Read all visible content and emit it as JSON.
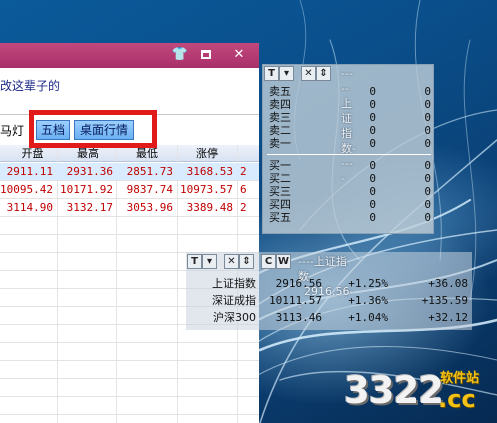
{
  "window": {
    "controls": {
      "skin": "👕",
      "maximize": "□",
      "close": "✕"
    },
    "info_text": "改这辈子的"
  },
  "tabs": {
    "marquee_label": "马灯",
    "five_levels": "五档",
    "desktop_quotes": "桌面行情"
  },
  "grid": {
    "headers": [
      "开盘",
      "最高",
      "最低",
      "涨停"
    ],
    "rows": [
      [
        "2911.11",
        "2931.36",
        "2851.73",
        "3168.53"
      ],
      [
        "10095.42",
        "10171.92",
        "9837.74",
        "10973.57"
      ],
      [
        "3114.90",
        "3132.17",
        "3053.96",
        "3389.48"
      ]
    ],
    "row_tails": [
      "2",
      "6",
      "2"
    ]
  },
  "order_book": {
    "toolbar": [
      "T",
      "▾",
      "✕",
      "⇕"
    ],
    "title": "上证指数",
    "sell_rows": [
      {
        "label": "卖五",
        "v1": "0",
        "v2": "0"
      },
      {
        "label": "卖四",
        "v1": "0",
        "v2": "0"
      },
      {
        "label": "卖三",
        "v1": "0",
        "v2": "0"
      },
      {
        "label": "卖二",
        "v1": "0",
        "v2": "0"
      },
      {
        "label": "卖一",
        "v1": "0",
        "v2": "0"
      }
    ],
    "buy_rows": [
      {
        "label": "买一",
        "v1": "0",
        "v2": "0"
      },
      {
        "label": "买二",
        "v1": "0",
        "v2": "0"
      },
      {
        "label": "买三",
        "v1": "0",
        "v2": "0"
      },
      {
        "label": "买四",
        "v1": "0",
        "v2": "0"
      },
      {
        "label": "买五",
        "v1": "0",
        "v2": "0"
      }
    ]
  },
  "index_widget": {
    "toolbar": [
      "T",
      "▾",
      "✕",
      "⇕",
      "C",
      "W"
    ],
    "title": "上证指数",
    "title_value": "2916.56",
    "rows": [
      {
        "name": "上证指数",
        "value": "2916.56",
        "pct": "+1.25%",
        "chg": "+36.08"
      },
      {
        "name": "深证成指",
        "value": "10111.57",
        "pct": "+1.36%",
        "chg": "+135.59"
      },
      {
        "name": "沪深300",
        "value": "3113.46",
        "pct": "+1.04%",
        "chg": "+32.12"
      }
    ]
  },
  "watermark": {
    "main": "3322",
    "domain": ".cc",
    "tag": "软件站"
  },
  "colors": {
    "title_bar": "#b23a70",
    "highlight": "#e11a1a",
    "tab": "#7ab9f5",
    "price_red": "#c00000"
  }
}
